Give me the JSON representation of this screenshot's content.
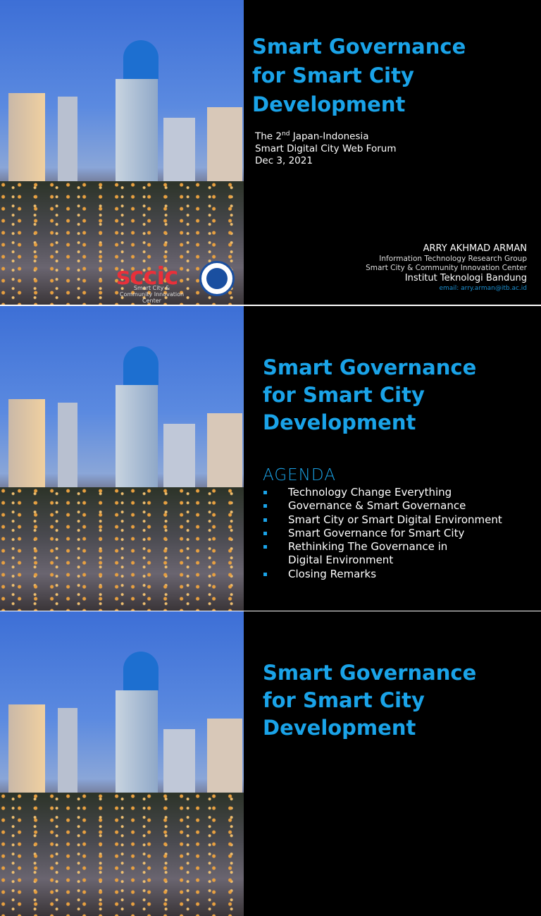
{
  "slides": [
    {
      "title": [
        "Smart Governance",
        "for Smart City",
        "Development"
      ],
      "event": {
        "line1_pre": "The 2",
        "line1_sup": "nd",
        "line1_post": " Japan-Indonesia",
        "line2": "Smart Digital City Web Forum",
        "date": "Dec 3, 2021"
      },
      "author": {
        "name": "ARRY AKHMAD ARMAN",
        "group": "Information Technology Research Group",
        "center": "Smart City & Community Innovation Center",
        "institute": "Institut Teknologi Bandung",
        "email": "email: arry.arman@itb.ac.id"
      },
      "logo": {
        "text": "SCCIC",
        "subtitle": "Smart City & Community Innovation Center",
        "seal": "Institut Teknologi Bandung 1920"
      }
    },
    {
      "title": [
        "Smart Governance",
        "for Smart City",
        "Development"
      ],
      "agenda_heading": "AGENDA",
      "agenda": [
        "Technology Change Everything",
        "Governance & Smart Governance",
        "Smart City or Smart Digital Environment",
        "Smart Governance for Smart City",
        "Rethinking The Governance in Digital Environment",
        "Closing Remarks"
      ]
    },
    {
      "title": [
        "Smart Governance",
        "for Smart City",
        "Development"
      ]
    }
  ],
  "colors": {
    "accent": "#1aa3e8",
    "background": "#000000"
  }
}
